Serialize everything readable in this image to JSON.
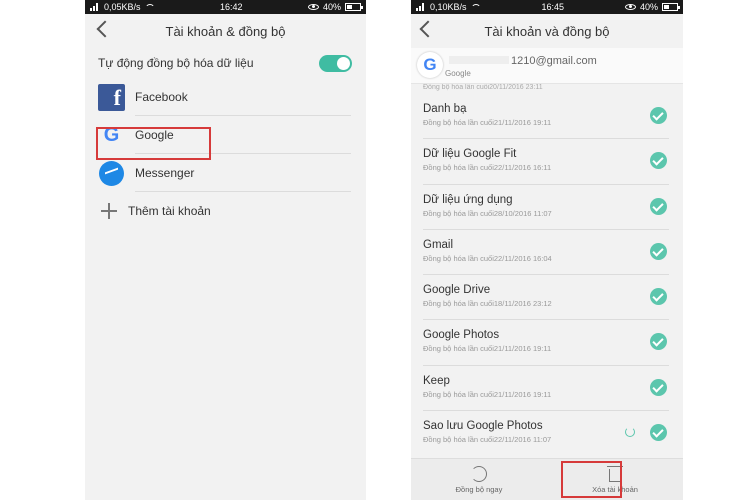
{
  "left": {
    "status": {
      "left": "0,05KB/s",
      "time": "16:42",
      "battery": "40%"
    },
    "title": "Tài khoản & đồng bộ",
    "sync_label": "Tự động đồng bộ hóa dữ liệu",
    "accounts": [
      {
        "label": "Facebook",
        "icon": "facebook-icon"
      },
      {
        "label": "Google",
        "icon": "google-icon"
      },
      {
        "label": "Messenger",
        "icon": "messenger-icon"
      }
    ],
    "add_account": "Thêm tài khoản"
  },
  "right": {
    "status": {
      "left": "0,10KB/s",
      "time": "16:45",
      "battery": "40%"
    },
    "title": "Tài khoản và đồng bộ",
    "account_email": "1210@gmail.com",
    "account_type": "Google",
    "partial_text": "Đồng bộ hóa lần cuối20/11/2016 23:11",
    "items": [
      {
        "name": "Danh bạ",
        "sub": "Đồng bộ hóa lần cuối21/11/2016 19:11"
      },
      {
        "name": "Dữ liệu Google Fit",
        "sub": "Đồng bộ hóa lần cuối22/11/2016 16:11"
      },
      {
        "name": "Dữ liệu ứng dụng",
        "sub": "Đồng bộ hóa lần cuối28/10/2016 11:07"
      },
      {
        "name": "Gmail",
        "sub": "Đồng bộ hóa lần cuối22/11/2016 16:04"
      },
      {
        "name": "Google Drive",
        "sub": "Đồng bộ hóa lần cuối18/11/2016 23:12"
      },
      {
        "name": "Google Photos",
        "sub": "Đồng bộ hóa lần cuối21/11/2016 19:11"
      },
      {
        "name": "Keep",
        "sub": "Đồng bộ hóa lần cuối21/11/2016 19:11"
      },
      {
        "name": "Sao lưu Google Photos",
        "sub": "Đồng bộ hóa lần cuối22/11/2016 11:07"
      }
    ],
    "bottom": {
      "sync_now": "Đồng bộ ngay",
      "delete": "Xóa tài khoản"
    }
  },
  "colors": {
    "accent": "#3fbca2",
    "highlight": "#d63a3a"
  }
}
